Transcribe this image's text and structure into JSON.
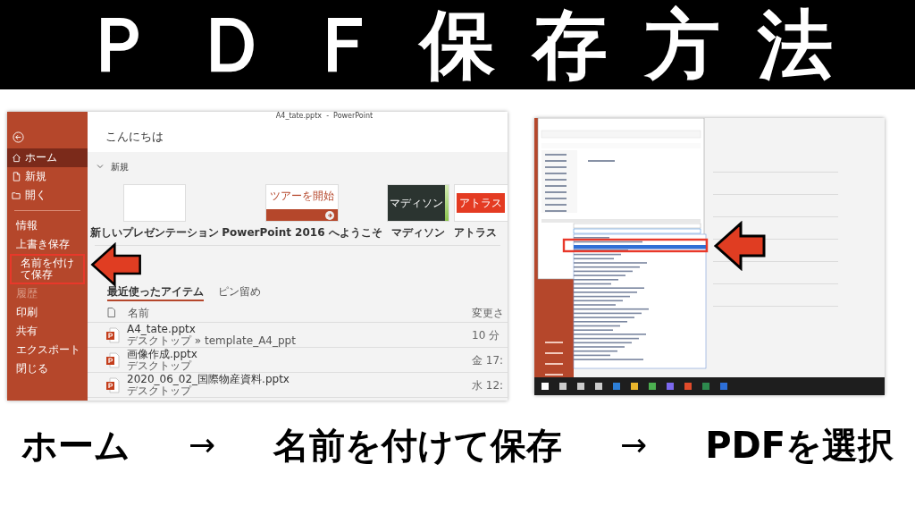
{
  "banner": {
    "title": "ＰＤＦ保存方法"
  },
  "powerpoint_window": {
    "title": "A4_tate.pptx  -  PowerPoint",
    "greeting": "こんにちは",
    "sidebar": [
      {
        "kind": "home",
        "label": "ホーム",
        "selected": true,
        "highlighted": false,
        "disabled": false
      },
      {
        "kind": "new",
        "label": "新規",
        "selected": false,
        "highlighted": false,
        "disabled": false
      },
      {
        "kind": "open",
        "label": "開く",
        "selected": false,
        "highlighted": false,
        "disabled": false
      },
      {
        "kind": "divider"
      },
      {
        "kind": "nav",
        "label": "情報",
        "selected": false,
        "highlighted": false,
        "disabled": false
      },
      {
        "kind": "nav",
        "label": "上書き保存",
        "selected": false,
        "highlighted": false,
        "disabled": false
      },
      {
        "kind": "nav",
        "label": "名前を付けて保存",
        "selected": false,
        "highlighted": true,
        "disabled": false
      },
      {
        "kind": "nav",
        "label": "履歴",
        "selected": false,
        "highlighted": false,
        "disabled": true
      },
      {
        "kind": "nav",
        "label": "印刷",
        "selected": false,
        "highlighted": false,
        "disabled": false
      },
      {
        "kind": "nav",
        "label": "共有",
        "selected": false,
        "highlighted": false,
        "disabled": false
      },
      {
        "kind": "nav",
        "label": "エクスポート",
        "selected": false,
        "highlighted": false,
        "disabled": false
      },
      {
        "kind": "nav",
        "label": "閉じる",
        "selected": false,
        "highlighted": false,
        "disabled": false
      }
    ],
    "new_section": {
      "heading": "新規",
      "templates": [
        {
          "kind": "blank",
          "label": "新しいプレゼンテーション"
        },
        {
          "kind": "tour",
          "label": "PowerPoint 2016 へようこそ",
          "thumbnail_text": "ツアーを開始"
        },
        {
          "kind": "madison",
          "label": "マディソン",
          "thumbnail_text": "マディソン"
        },
        {
          "kind": "atlas",
          "label": "アトラス",
          "thumbnail_text": "アトラス"
        }
      ]
    },
    "tabs": [
      {
        "label": "最近使ったアイテム",
        "selected": true
      },
      {
        "label": "ピン留め",
        "selected": false
      }
    ],
    "columns": {
      "name": "名前",
      "modified": "変更さ"
    },
    "files": [
      {
        "name": "A4_tate.pptx",
        "path": "デスクトップ » template_A4_ppt",
        "modified": "10 分"
      },
      {
        "name": "画像作成.pptx",
        "path": "デスクトップ",
        "modified": "金 17:"
      },
      {
        "name": "2020_06_02_国際物産資料.pptx",
        "path": "デスクトップ",
        "modified": "水 12:"
      }
    ]
  },
  "steps": [
    {
      "kind": "step",
      "text": "ホーム"
    },
    {
      "kind": "arrow",
      "text": "→"
    },
    {
      "kind": "step",
      "text": "名前を付けて保存"
    },
    {
      "kind": "arrow",
      "text": "→"
    },
    {
      "kind": "step",
      "text": "PDFを選択"
    }
  ]
}
